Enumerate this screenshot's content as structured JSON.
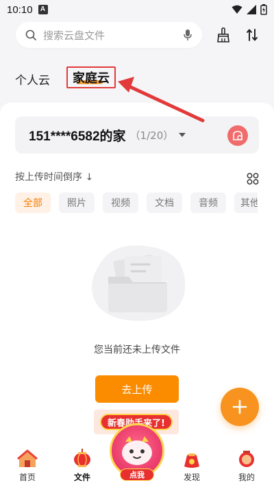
{
  "status_bar": {
    "time": "10:10",
    "badge": "A"
  },
  "search": {
    "placeholder": "搜索云盘文件"
  },
  "tabs": {
    "personal": "个人云",
    "family": "家庭云"
  },
  "family": {
    "name": "151****6582的家",
    "count": "（1/20）"
  },
  "sort": {
    "label": "按上传时间倒序 ↓"
  },
  "filters": [
    "全部",
    "照片",
    "视频",
    "文档",
    "音频",
    "其他"
  ],
  "empty": {
    "message": "您当前还未上传文件"
  },
  "upload_button": "去上传",
  "promo": {
    "banner": "新春助手来了!",
    "mascot_label": "点我"
  },
  "bottom_nav": [
    {
      "label": "首页",
      "icon": "home-icon"
    },
    {
      "label": "文件",
      "icon": "files-icon"
    },
    {
      "label": "发现",
      "icon": "discover-icon"
    },
    {
      "label": "我的",
      "icon": "profile-icon"
    }
  ],
  "colors": {
    "accent": "#fb8c00",
    "annotation_red": "#e23a3a",
    "background": "#f5f5f7"
  }
}
